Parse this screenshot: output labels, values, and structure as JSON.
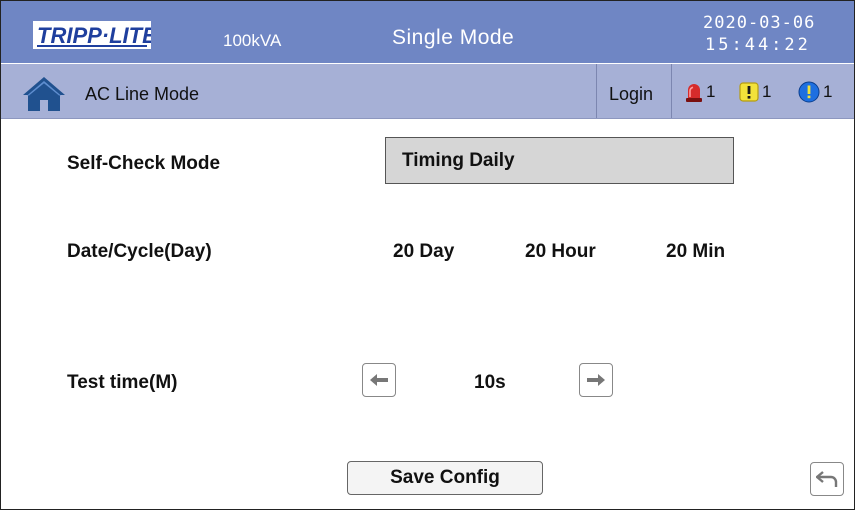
{
  "header": {
    "brand": "TRIPP·LITE",
    "capacity": "100kVA",
    "mode_title": "Single Mode",
    "date": "2020-03-06",
    "time": "15:44:22"
  },
  "statusbar": {
    "line_mode": "AC Line Mode",
    "login_label": "Login",
    "alarms": {
      "critical_count": "1",
      "warning_count": "1",
      "info_count": "1"
    }
  },
  "form": {
    "self_check_label": "Self-Check Mode",
    "self_check_value": "Timing Daily",
    "date_cycle_label": "Date/Cycle(Day)",
    "day_value": "20 Day",
    "hour_value": "20 Hour",
    "min_value": "20 Min",
    "test_time_label": "Test time(M)",
    "test_time_value": "10s",
    "save_label": "Save Config"
  },
  "colors": {
    "topbar": "#6f86c4",
    "statusbar": "#a6b0d6",
    "brand_blue": "#1f3f9e",
    "critical": "#d62b2b",
    "warning": "#f2e23a",
    "info": "#1e6fe0"
  },
  "icons": {
    "home": "home-icon",
    "critical": "siren-icon",
    "warning": "exclamation-warning-icon",
    "info": "exclamation-info-icon",
    "left": "arrow-left-icon",
    "right": "arrow-right-icon",
    "back": "return-icon"
  }
}
